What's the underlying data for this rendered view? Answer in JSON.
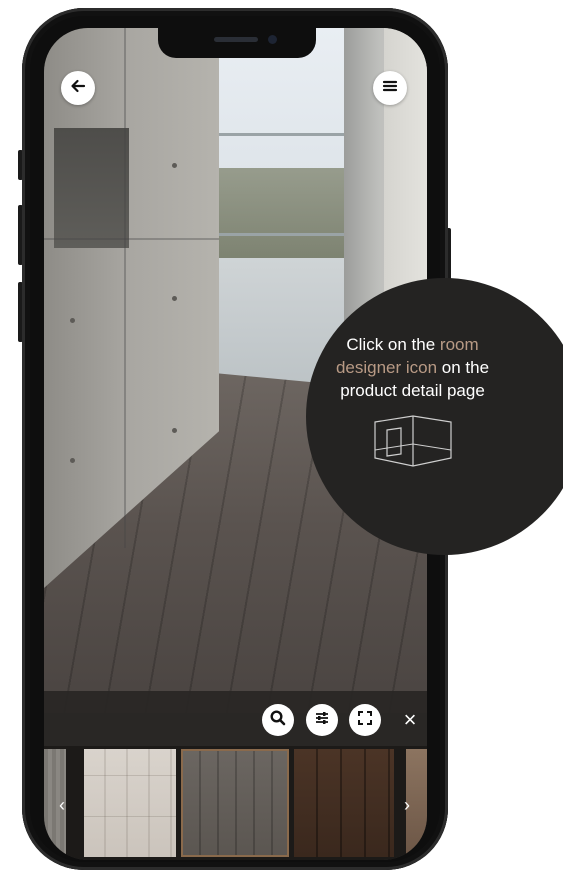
{
  "toolbar": {
    "back_icon": "arrow-left-icon",
    "menu_icon": "hamburger-menu-icon",
    "search_icon": "search-icon",
    "filter_icon": "sliders-icon",
    "fullscreen_icon": "fullscreen-icon",
    "close_label": "×"
  },
  "swatches": {
    "prev_label": "‹",
    "next_label": "›"
  },
  "info_bubble": {
    "part1": "Click on the ",
    "highlight": "room designer icon",
    "part2": " on the product detail page",
    "icon": "room-designer-icon"
  },
  "colors": {
    "accent": "#b89a85",
    "bubble_bg": "#242322",
    "selected_border": "#8a6a4c"
  }
}
